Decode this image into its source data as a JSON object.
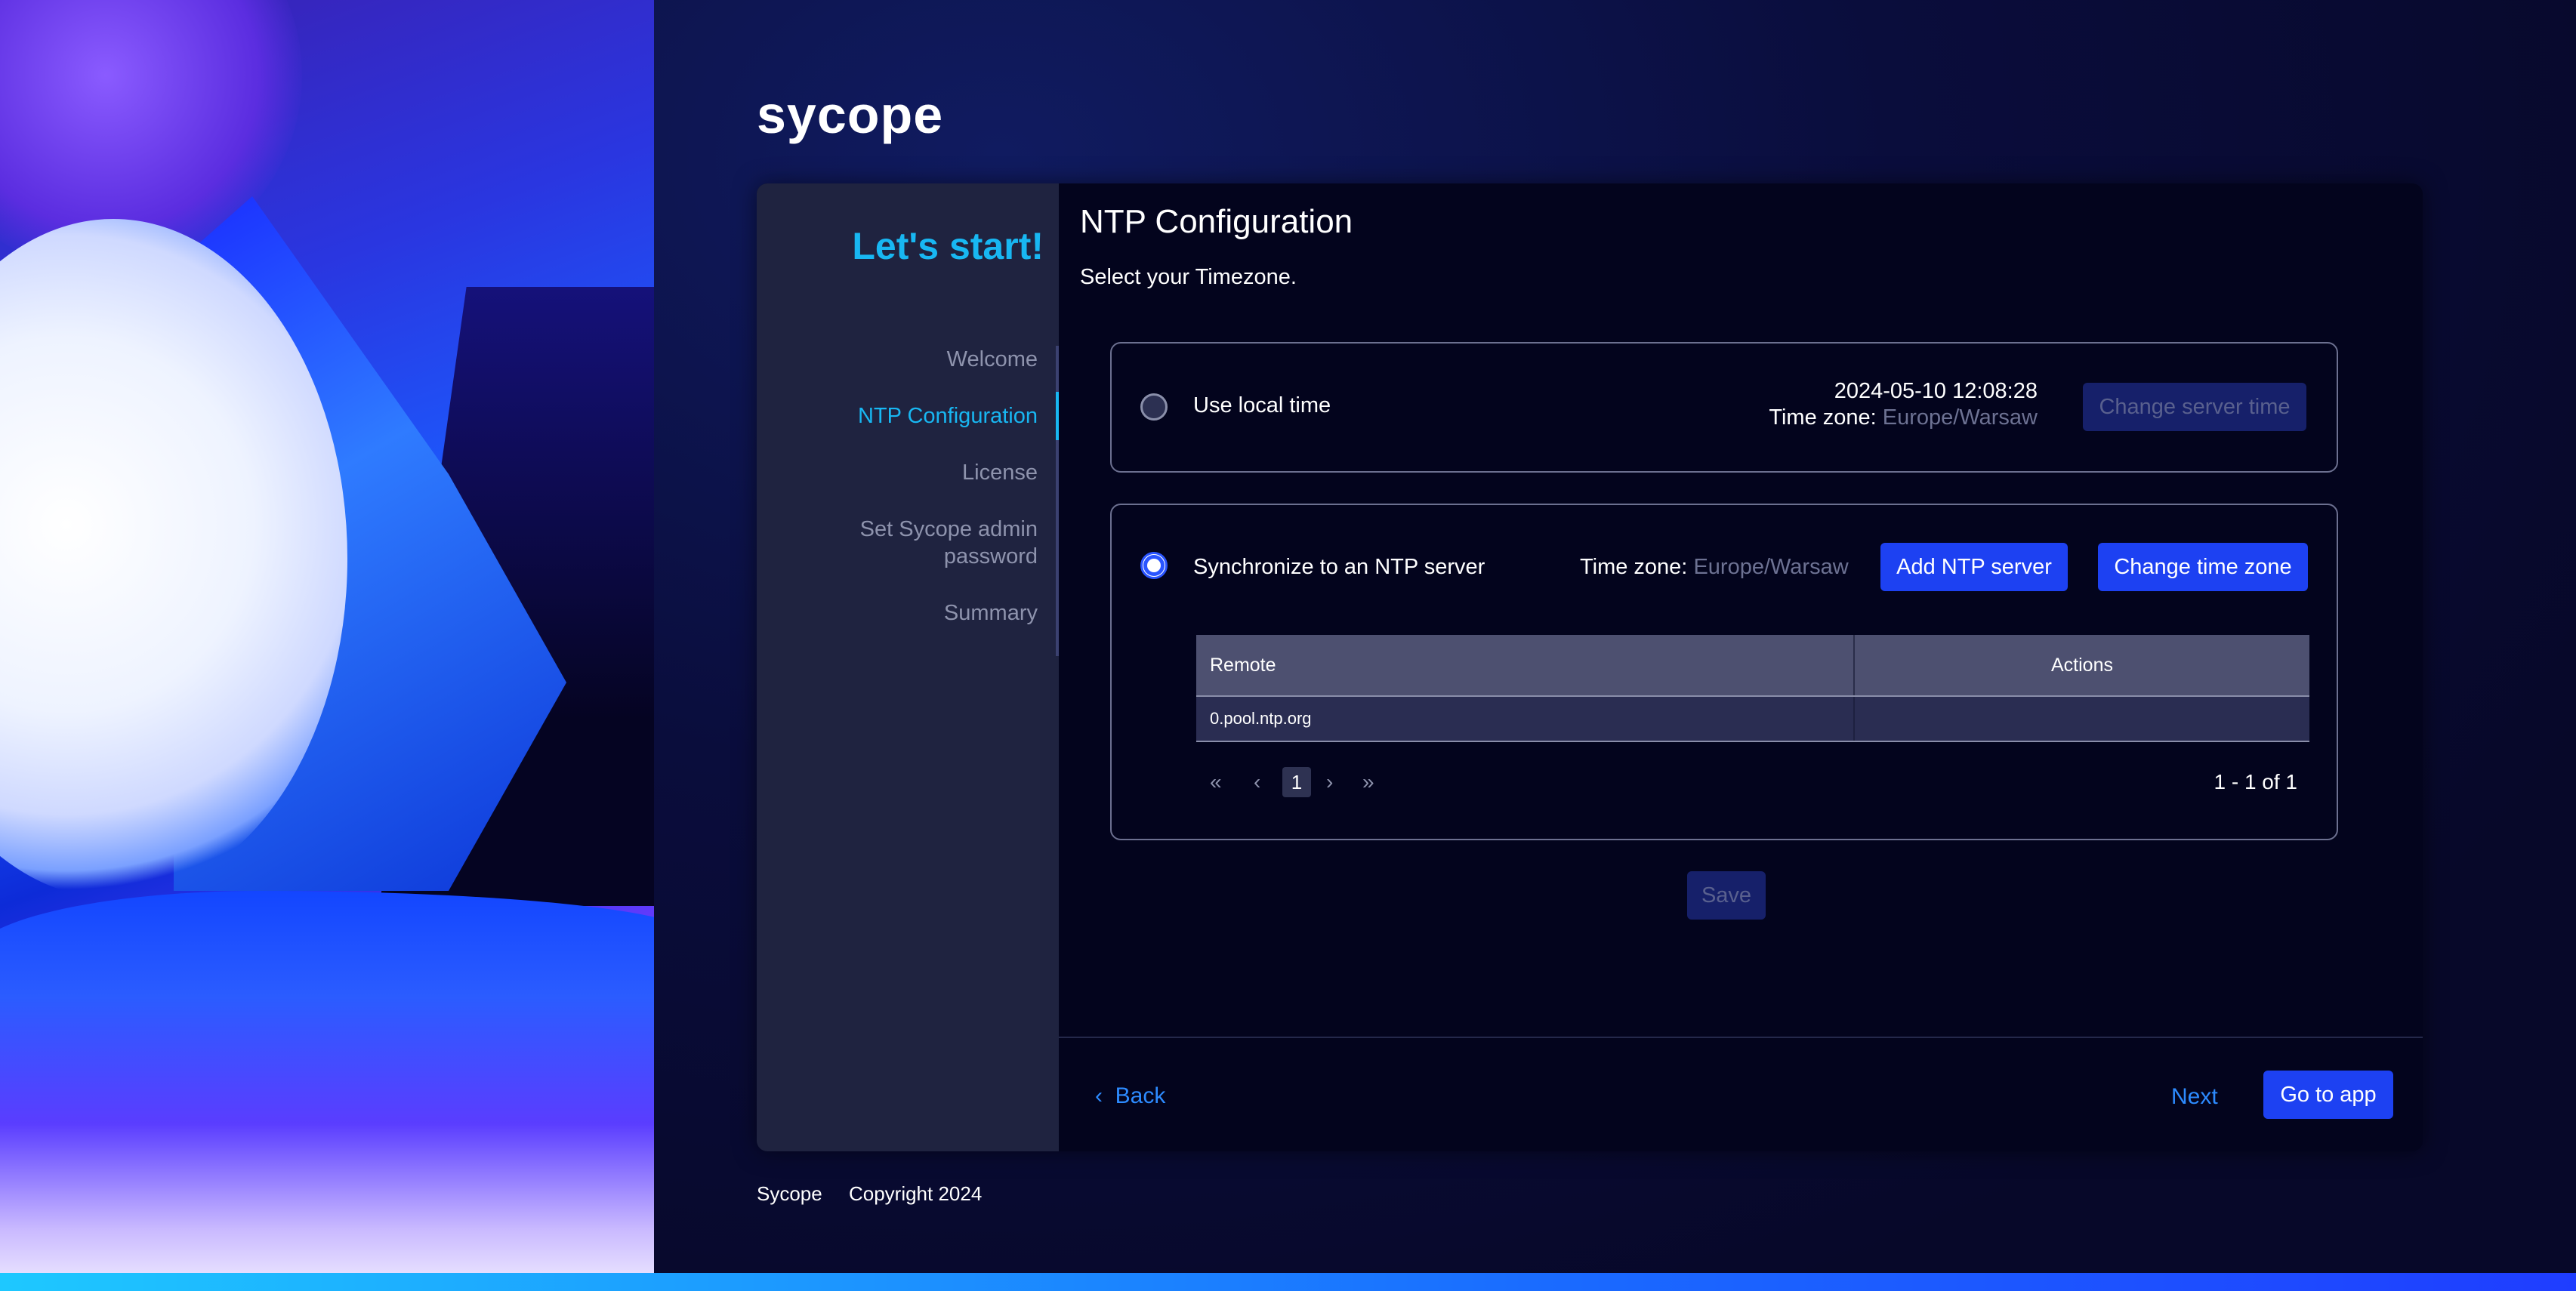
{
  "brand": {
    "logo": "sycope"
  },
  "sidebar": {
    "heading": "Let's start!",
    "steps": [
      {
        "label": "Welcome"
      },
      {
        "label": "NTP Configuration"
      },
      {
        "label": "License"
      },
      {
        "label": "Set Sycope admin password"
      },
      {
        "label": "Summary"
      }
    ]
  },
  "main": {
    "title": "NTP Configuration",
    "subtitle": "Select your Timezone.",
    "local": {
      "label": "Use local time",
      "datetime": "2024-05-10 12:08:28",
      "tz_label": "Time zone:",
      "tz_value": "Europe/Warsaw",
      "change_server_time": "Change server time"
    },
    "ntp": {
      "label": "Synchronize to an NTP server",
      "tz_label": "Time zone:",
      "tz_value": "Europe/Warsaw",
      "add_ntp_server": "Add NTP server",
      "change_time_zone": "Change time zone",
      "table": {
        "columns": [
          "Remote",
          "Actions"
        ],
        "rows": [
          {
            "remote": "0.pool.ntp.org",
            "actions": ""
          }
        ]
      },
      "pager": {
        "first": "«",
        "prev": "‹",
        "page": "1",
        "next": "›",
        "last": "»",
        "count": "1 - 1 of 1"
      }
    },
    "save": "Save",
    "back": "Back",
    "next": "Next",
    "go_to_app": "Go to app"
  },
  "footer": {
    "company": "Sycope",
    "copyright": "Copyright 2024"
  },
  "colors": {
    "accent": "#18b7f2",
    "primary_button": "#1d41f2",
    "link": "#2d8bff",
    "background": "#07082a"
  }
}
